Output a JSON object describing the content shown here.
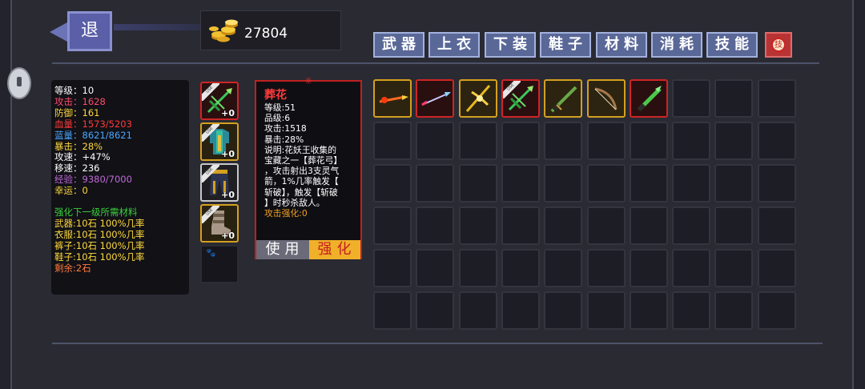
{
  "header": {
    "back_label": "退",
    "gold_amount": "27804"
  },
  "tabs": [
    {
      "label": "武器"
    },
    {
      "label": "上衣"
    },
    {
      "label": "下装"
    },
    {
      "label": "鞋子"
    },
    {
      "label": "材料"
    },
    {
      "label": "消耗"
    },
    {
      "label": "技能"
    }
  ],
  "skill_tab_icon": "skill-refresh-icon",
  "stats": {
    "level": "等级：10",
    "attack": "攻击：1628",
    "defense": "防御：161",
    "hp": "血量：1573/5203",
    "mp": "蓝量：8621/8621",
    "crit": "暴击：28%",
    "attack_speed": "攻速：+47%",
    "move_speed": "移速：236",
    "exp": "经验：9380/7000",
    "luck": "幸运：0",
    "upgrade_title": "强化下一级所需材料",
    "weapon_req": "武器:10石 100%几率",
    "clothes_req": "衣服:10石 100%几率",
    "pants_req": "裤子:10石 100%几率",
    "shoes_req": "鞋子:10石 100%几率",
    "remaining": "剩余:2石"
  },
  "stat_colors": {
    "white": "#ffffff",
    "red": "#ff4a6a",
    "blue": "#4aa8ff",
    "yellow": "#ffd83a",
    "purple": "#c06ad8",
    "green": "#3ccf3c"
  },
  "equipment": [
    {
      "name": "bow",
      "plus": "+0",
      "rarity": "red",
      "tag": "USE"
    },
    {
      "name": "armor",
      "plus": "+0",
      "rarity": "gold",
      "tag": "USE"
    },
    {
      "name": "pants",
      "plus": "+0",
      "rarity": "silver",
      "tag": "USE"
    },
    {
      "name": "boots",
      "plus": "+0",
      "rarity": "gold",
      "tag": "USE"
    },
    {
      "name": "pet-slot",
      "plus": "",
      "rarity": "empty",
      "tag": ""
    }
  ],
  "tooltip": {
    "name": "葬花",
    "level": "等级:51",
    "grade": "品级:6",
    "attack": "攻击:1518",
    "crit": "暴击:28%",
    "desc_1": "说明:花妖王收集的",
    "desc_2": "宝藏之一【葬花弓】",
    "desc_3": "，攻击射出3支灵气",
    "desc_4": "箭，1%几率触发【",
    "desc_5": "斩破】，触发【斩破",
    "desc_6": "】时秒杀敌人。",
    "enhance": "攻击强化:0",
    "use_label": "使用",
    "strengthen_label": "强化"
  },
  "inventory": [
    {
      "item": "fire-arrow",
      "rarity": "gold"
    },
    {
      "item": "ice-arrow",
      "rarity": "red"
    },
    {
      "item": "golden-crossbow",
      "rarity": "gold"
    },
    {
      "item": "flower-bow",
      "rarity": "red",
      "tag": "USE"
    },
    {
      "item": "green-sword",
      "rarity": "gold"
    },
    {
      "item": "longbow",
      "rarity": "gold"
    },
    {
      "item": "jade-blade",
      "rarity": "red"
    }
  ],
  "inventory_slots": 60
}
